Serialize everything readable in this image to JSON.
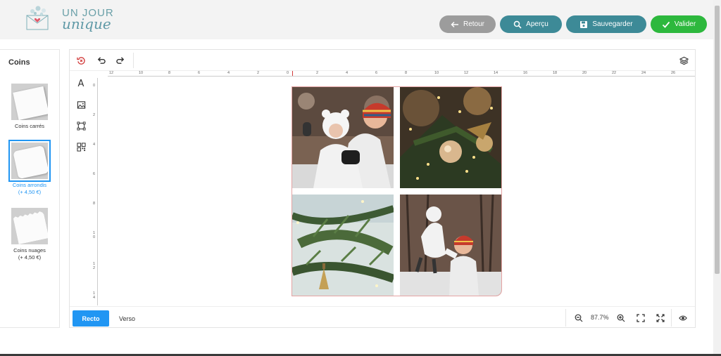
{
  "header": {
    "logo_top": "UN JOUR",
    "logo_bottom": "unique",
    "buttons": {
      "retour": "Retour",
      "apercu": "Aperçu",
      "sauvegarder": "Sauvegarder",
      "valider": "Valider"
    }
  },
  "sidebar": {
    "title": "Coins",
    "options": [
      {
        "label": "Coins carrés",
        "price": ""
      },
      {
        "label": "Coins arrondis",
        "price": "(+ 4,50 €)"
      },
      {
        "label": "Coins nuages",
        "price": "(+ 4,50 €)"
      }
    ],
    "selected_index": 1
  },
  "ruler": {
    "horizontal": [
      "12",
      "10",
      "8",
      "6",
      "4",
      "2",
      "0",
      "2",
      "4",
      "6",
      "8",
      "10",
      "12",
      "14",
      "16",
      "18",
      "20",
      "22",
      "24",
      "26"
    ],
    "vertical": [
      "0",
      "2",
      "4",
      "6",
      "8",
      "1 0",
      "1 2",
      "1 4"
    ]
  },
  "bottom": {
    "tab_recto": "Recto",
    "tab_verso": "Verso",
    "zoom": "87.7%"
  },
  "colors": {
    "teal": "#3d8a97",
    "green": "#2db83d",
    "gray": "#9c9c9c",
    "blue": "#2196f3"
  }
}
